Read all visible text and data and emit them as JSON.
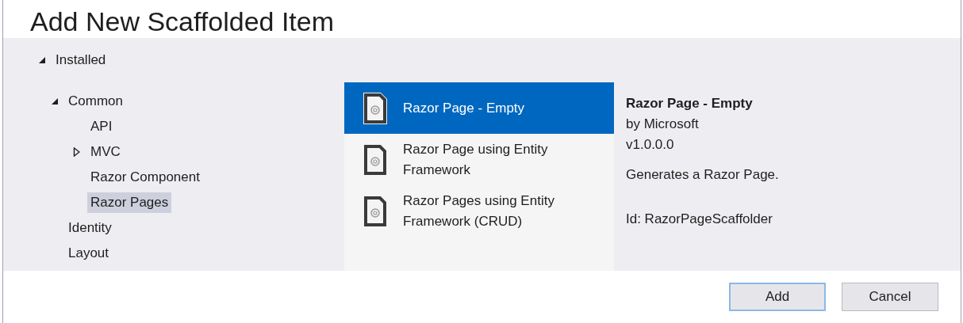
{
  "window": {
    "title": "Add New Scaffolded Item"
  },
  "tree": [
    {
      "label": "Installed",
      "selected": false,
      "expanded": true,
      "children": [
        {
          "label": "Common",
          "selected": false,
          "expanded": true,
          "children": [
            {
              "label": "API",
              "selected": false
            },
            {
              "label": "MVC",
              "selected": false,
              "expanded": false
            },
            {
              "label": "Razor Component",
              "selected": false
            },
            {
              "label": "Razor Pages",
              "selected": true
            }
          ]
        },
        {
          "label": "Identity",
          "selected": false
        },
        {
          "label": "Layout",
          "selected": false
        }
      ]
    }
  ],
  "templates": [
    {
      "name": "Razor Page - Empty",
      "selected": true
    },
    {
      "name": "Razor Page using Entity Framework",
      "selected": false
    },
    {
      "name": "Razor Pages using Entity Framework (CRUD)",
      "selected": false
    }
  ],
  "details": {
    "title": "Razor Page - Empty",
    "author": "by Microsoft",
    "version": "v1.0.0.0",
    "description": "Generates a Razor Page.",
    "id": "Id: RazorPageScaffolder"
  },
  "buttons": [
    {
      "label": "Add",
      "default": true
    },
    {
      "label": "Cancel",
      "default": false
    }
  ]
}
